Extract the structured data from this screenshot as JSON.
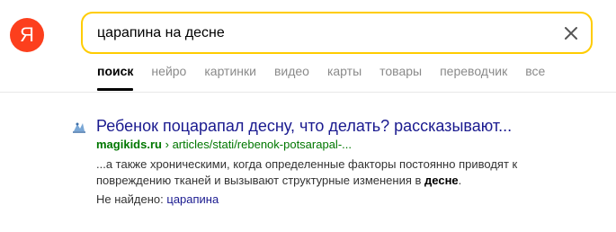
{
  "logo": {
    "letter": "Я",
    "color": "#fc3f1d"
  },
  "search": {
    "value": "царапина на десне",
    "border_color": "#ffcc00",
    "clear_icon": "close-icon"
  },
  "tabs": [
    {
      "label": "поиск",
      "active": true
    },
    {
      "label": "нейро",
      "active": false
    },
    {
      "label": "картинки",
      "active": false
    },
    {
      "label": "видео",
      "active": false
    },
    {
      "label": "карты",
      "active": false
    },
    {
      "label": "товары",
      "active": false
    },
    {
      "label": "переводчик",
      "active": false
    },
    {
      "label": "все",
      "active": false
    }
  ],
  "result": {
    "favicon": "magikids-favicon",
    "title": "Ребенок поцарапал десну, что делать? рассказывают...",
    "domain": "magikids.ru",
    "separator": "›",
    "path": "articles/stati/rebenok-potsarapal-...",
    "snippet_part1": "...а также хроническими, когда определенные факторы постоянно приводят к повреждению тканей и вызывают структурные изменения в ",
    "snippet_bold": "десне",
    "snippet_part2": ".",
    "not_found_label": "Не найдено:",
    "not_found_term": "царапина"
  }
}
